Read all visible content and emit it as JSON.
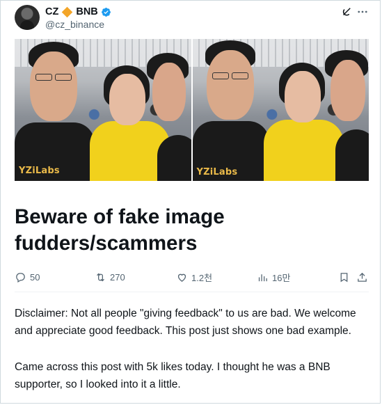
{
  "author": {
    "display_name_left": "CZ",
    "display_name_right": "BNB",
    "handle": "@cz_binance",
    "avatar": "avatar-photo",
    "badge_icon": "verified-badge-icon",
    "emoji_icon": "orange-diamond-icon"
  },
  "header_icons": [
    "grok-icon",
    "more-icon"
  ],
  "photos": [
    {
      "logo_text": "YZiLabs"
    },
    {
      "logo_text": "YZiLabs"
    }
  ],
  "post": {
    "title": "Beware of fake image fudders/scammers",
    "paragraph_1": "Disclaimer: Not all people \"giving feedback\" to us are bad. We welcome and appreciate good feedback. This post just shows one bad example.",
    "paragraph_2": "Came across this post with 5k likes today. I thought he was a BNB supporter, so I looked into it a little."
  },
  "actions": {
    "replies": "50",
    "reposts": "270",
    "likes": "1.2천",
    "views": "16만"
  },
  "colors": {
    "accent_blue": "#1d9bf0",
    "muted_text": "#536471",
    "diamond_orange": "#f3a528",
    "shirt_yellow": "#f1d11c"
  }
}
